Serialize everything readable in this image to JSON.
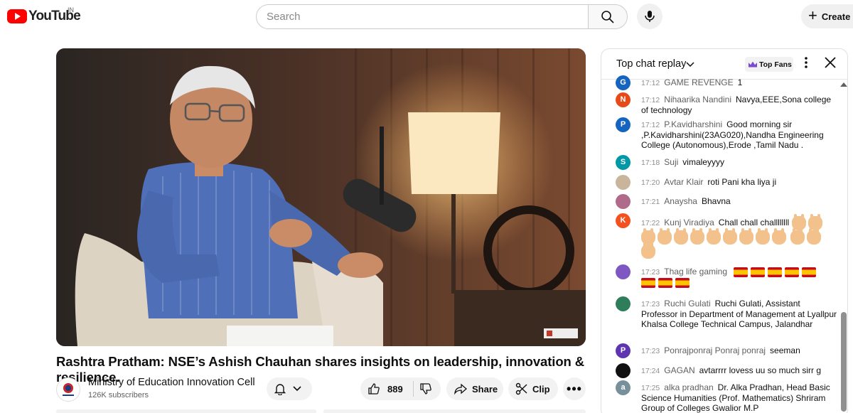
{
  "header": {
    "logo_text": "YouTube",
    "country_code": "IN",
    "search_placeholder": "Search",
    "create_label": "Create"
  },
  "video": {
    "title": "Rashtra Pratham: NSE’s Ashish Chauhan shares insights on leadership, innovation & resilience.",
    "channel_name": "Ministry of Education Innovation Cell",
    "subscribers": "126K subscribers",
    "like_count": "889",
    "share_label": "Share",
    "clip_label": "Clip",
    "more_label": "•••"
  },
  "chat": {
    "title": "Top chat replay",
    "top_fans_label": "Top Fans",
    "messages": [
      {
        "initial": "G",
        "color": "#1565c0",
        "time": "17:12",
        "author": "GAME REVENGE",
        "text": "1"
      },
      {
        "initial": "N",
        "color": "#e64a19",
        "time": "17:12",
        "author": "Nihaarika Nandini",
        "text": "Navya,EEE,Sona college of technology"
      },
      {
        "initial": "P",
        "color": "#1565c0",
        "time": "17:12",
        "author": "P.Kavidharshini",
        "text": "Good morning sir ,P.Kavidharshini(23AG020),Nandha Engineering College (Autonomous),Erode ,Tamil Nadu ."
      },
      {
        "initial": "S",
        "color": "#0097a7",
        "time": "17:18",
        "author": "Suji",
        "text": "vimaleyyyy"
      },
      {
        "initial": "",
        "color": "#c9b59b",
        "time": "17:20",
        "author": "Avtar Klair",
        "text": "roti Pani kha liya ji"
      },
      {
        "initial": "",
        "color": "#b06a8a",
        "time": "17:21",
        "author": "Anaysha",
        "text": "Bhavna"
      },
      {
        "initial": "K",
        "color": "#f4511e",
        "time": "17:22",
        "author": "Kunj Viradiya",
        "text": "Chall chall challllllll"
      },
      {
        "initial": "",
        "color": "#7e57c2",
        "time": "17:23",
        "author": "Thag life gaming",
        "text": ""
      },
      {
        "initial": "",
        "color": "#2e7d5b",
        "time": "17:23",
        "author": "Ruchi Gulati",
        "text": "Ruchi Gulati, Assistant Professor in Department of Management at Lyallpur Khalsa College Technical Campus, Jalandhar"
      },
      {
        "initial": "P",
        "color": "#5e35b1",
        "time": "17:23",
        "author": "Ponrajponraj Ponraj ponraj",
        "text": "seeman"
      },
      {
        "initial": "",
        "color": "#111111",
        "time": "17:24",
        "author": "GAGAN",
        "text": "avtarrrr lovess uu so much sirr g"
      },
      {
        "initial": "a",
        "color": "#78909c",
        "time": "17:25",
        "author": "alka pradhan",
        "text": "Dr. Alka Pradhan, Head Basic Science Humanities (Prof. Mathematics) Shriram Group of Colleges Gwalior M.P"
      }
    ]
  }
}
